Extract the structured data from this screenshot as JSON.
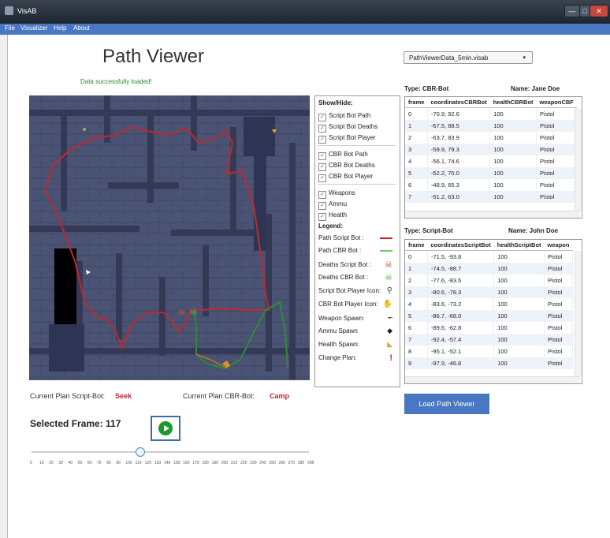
{
  "window": {
    "title": "VisAB",
    "min": "—",
    "max": "□",
    "close": "✕"
  },
  "menu": [
    "File",
    "Visualizer",
    "Help",
    "About"
  ],
  "page_title": "Path Viewer",
  "status": "Data successfully loaded!",
  "file_select": {
    "value": "PathViewerData_5min.visab",
    "arrow": "▾"
  },
  "panel": {
    "header": "Show/Hide:",
    "script_items": [
      "Script Bot Path",
      "Script Bot Deaths",
      "Script Bot Player"
    ],
    "cbr_items": [
      "CBR Bot Path",
      "CBR Bot Deaths",
      "CBR Bot Player"
    ],
    "spawn_items": [
      "Weapons",
      "Ammu",
      "Health"
    ],
    "legend_header": "Legend:",
    "legend": [
      {
        "label": "Path Script Bot :",
        "icon": "red-line"
      },
      {
        "label": "Path CBR Bot :",
        "icon": "green-line"
      },
      {
        "label": "Deaths Script Bot :",
        "icon": "red-skull-icon",
        "glyph": "☠"
      },
      {
        "label": "Deaths CBR Bot :",
        "icon": "green-skull-icon",
        "glyph": "☠"
      },
      {
        "label": "Script Bot Player Icon:",
        "icon": "script-player-icon",
        "glyph": "⚲"
      },
      {
        "label": "CBR Bot Player Icon:",
        "icon": "cbr-player-icon",
        "glyph": "✋"
      },
      {
        "label": "Weapon Spawn:",
        "icon": "weapon-icon",
        "glyph": "╾"
      },
      {
        "label": "Ammu Spawn",
        "icon": "ammo-icon",
        "glyph": "◆"
      },
      {
        "label": "Health Spawn:",
        "icon": "health-icon",
        "glyph": "◣"
      },
      {
        "label": "Change Plan:",
        "icon": "exclamation-icon",
        "glyph": "!"
      }
    ],
    "checkmark": "✓"
  },
  "plans": {
    "script_label": "Current Plan Script-Bot:",
    "script_value": "Seek",
    "cbr_label": "Current Plan CBR-Bot:",
    "cbr_value": "Camp"
  },
  "frame": {
    "label": "Selected Frame: 117",
    "value": 117,
    "max": 298
  },
  "slider_ticks": [
    "0",
    "10",
    "20",
    "30",
    "40",
    "50",
    "60",
    "70",
    "80",
    "90",
    "100",
    "110",
    "120",
    "130",
    "140",
    "150",
    "160",
    "170",
    "180",
    "190",
    "200",
    "210",
    "220",
    "230",
    "240",
    "250",
    "260",
    "270",
    "280",
    "298"
  ],
  "cbr_table": {
    "type_label": "Type: CBR-Bot",
    "name_label": "Name: Jane Doe",
    "columns": [
      "frame",
      "coordinatesCBRBot",
      "healthCBRBot",
      "weaponCBF"
    ],
    "rows": [
      [
        "0",
        "-70.9, 92.6",
        "100",
        "Pistol"
      ],
      [
        "1",
        "-67.5, 88.5",
        "100",
        "Pistol"
      ],
      [
        "2",
        "-63.7, 83.9",
        "100",
        "Pistol"
      ],
      [
        "3",
        "-59.9, 79.3",
        "100",
        "Pistol"
      ],
      [
        "4",
        "-56.1, 74.6",
        "100",
        "Pistol"
      ],
      [
        "5",
        "-52.2, 70.0",
        "100",
        "Pistol"
      ],
      [
        "6",
        "-48.9, 65.3",
        "100",
        "Pistol"
      ],
      [
        "7",
        "-51.2, 63.0",
        "100",
        "Pistol"
      ]
    ]
  },
  "script_table": {
    "type_label": "Type: Script-Bot",
    "name_label": "Name: John Doe",
    "columns": [
      "frame",
      "coordinatesScriptBot",
      "healthScriptBot",
      "weapon"
    ],
    "rows": [
      [
        "0",
        "-71.5, -93.8",
        "100",
        "Pistol"
      ],
      [
        "1",
        "-74.5, -88.7",
        "100",
        "Pistol"
      ],
      [
        "2",
        "-77.6, -83.5",
        "100",
        "Pistol"
      ],
      [
        "3",
        "-80.6, -78.3",
        "100",
        "Pistol"
      ],
      [
        "4",
        "-83.6, -73.2",
        "100",
        "Pistol"
      ],
      [
        "5",
        "-86.7, -68.0",
        "100",
        "Pistol"
      ],
      [
        "6",
        "-89.6, -62.8",
        "100",
        "Pistol"
      ],
      [
        "7",
        "-92.4, -57.4",
        "100",
        "Pistol"
      ],
      [
        "8",
        "-95.1, -52.1",
        "100",
        "Pistol"
      ],
      [
        "9",
        "-97.9, -46.8",
        "100",
        "Pistol"
      ]
    ]
  },
  "load_button": "Load Path Viewer",
  "colors": {
    "accent": "#4a77c2",
    "script_path": "#c0282f",
    "cbr_path": "#2f8a3a",
    "plan_value": "#c0282f"
  }
}
